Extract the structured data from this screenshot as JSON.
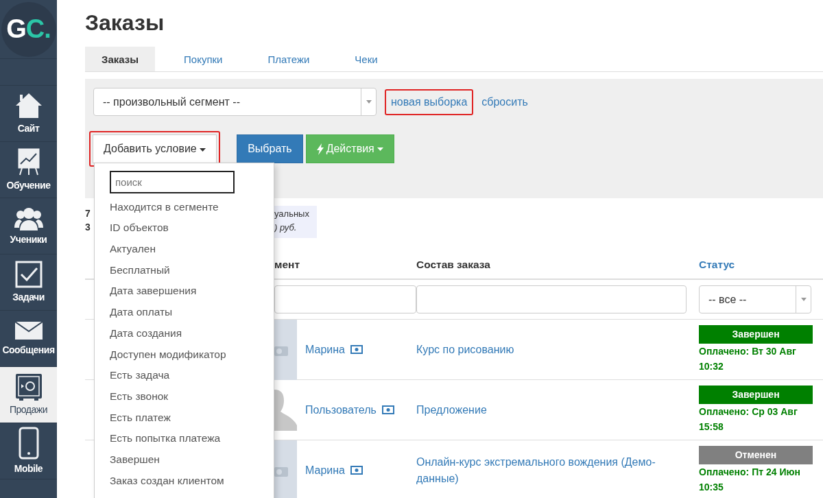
{
  "sidebar": {
    "logo": {
      "first": "G",
      "second": "C."
    },
    "items": [
      {
        "label": "Сайт",
        "kind": "house",
        "selected": false
      },
      {
        "label": "Обучение",
        "kind": "chart",
        "selected": false
      },
      {
        "label": "Ученики",
        "kind": "people",
        "selected": false
      },
      {
        "label": "Задачи",
        "kind": "checkbox",
        "selected": false
      },
      {
        "label": "Сообщения",
        "kind": "envelope",
        "selected": false
      },
      {
        "label": "Продажи",
        "kind": "safe",
        "selected": true
      },
      {
        "label": "Mobile",
        "kind": "phone",
        "selected": false
      }
    ]
  },
  "page_title": "Заказы",
  "tabs": [
    {
      "label": "Заказы",
      "selected": true
    },
    {
      "label": "Покупки",
      "selected": false
    },
    {
      "label": "Платежи",
      "selected": false
    },
    {
      "label": "Чеки",
      "selected": false
    }
  ],
  "filter": {
    "segment_select": "-- произвольный сегмент --",
    "new_selection_link": "новая выборка",
    "reset_link": "сбросить",
    "add_condition_button": "Добавить условие",
    "select_button": "Выбрать",
    "actions_button": "Действия"
  },
  "condition_menu": {
    "search_placeholder": "поиск",
    "items": [
      "Находится в сегменте",
      "ID объектов",
      "Актуален",
      "Бесплатный",
      "Дата завершения",
      "Дата оплаты",
      "Дата создания",
      "Доступен модификатор",
      "Есть задача",
      "Есть звонок",
      "Есть платеж",
      "Есть попытка платежа",
      "Завершен",
      "Заказ создан клиентом"
    ]
  },
  "stats": {
    "lines": [
      "7",
      "3"
    ],
    "info_lines": [
      "уальных",
      ") руб."
    ]
  },
  "table": {
    "columns": [
      "мент",
      "Состав заказа",
      "Статус"
    ],
    "status_filter": "-- все --",
    "rows": [
      {
        "client": "Марина",
        "kind": "photo",
        "composition": "Курс по рисованию",
        "status": {
          "label": "Завершен",
          "color": "#008000"
        },
        "paid": "Оплачено: Вт 30 Авг 10:32"
      },
      {
        "client": "Пользователь",
        "kind": "silhouette",
        "composition": "Предложение",
        "status": {
          "label": "Завершен",
          "color": "#008000"
        },
        "paid": "Оплачено: Ср 03 Авг 15:58"
      },
      {
        "client": "Марина",
        "kind": "photo",
        "composition": "Онлайн-курс экстремального вождения (Демо-данные)",
        "status": {
          "label": "Отменен",
          "color": "#808080"
        },
        "paid": "Оплачено: Пт 24 Июн 10:35"
      }
    ]
  }
}
